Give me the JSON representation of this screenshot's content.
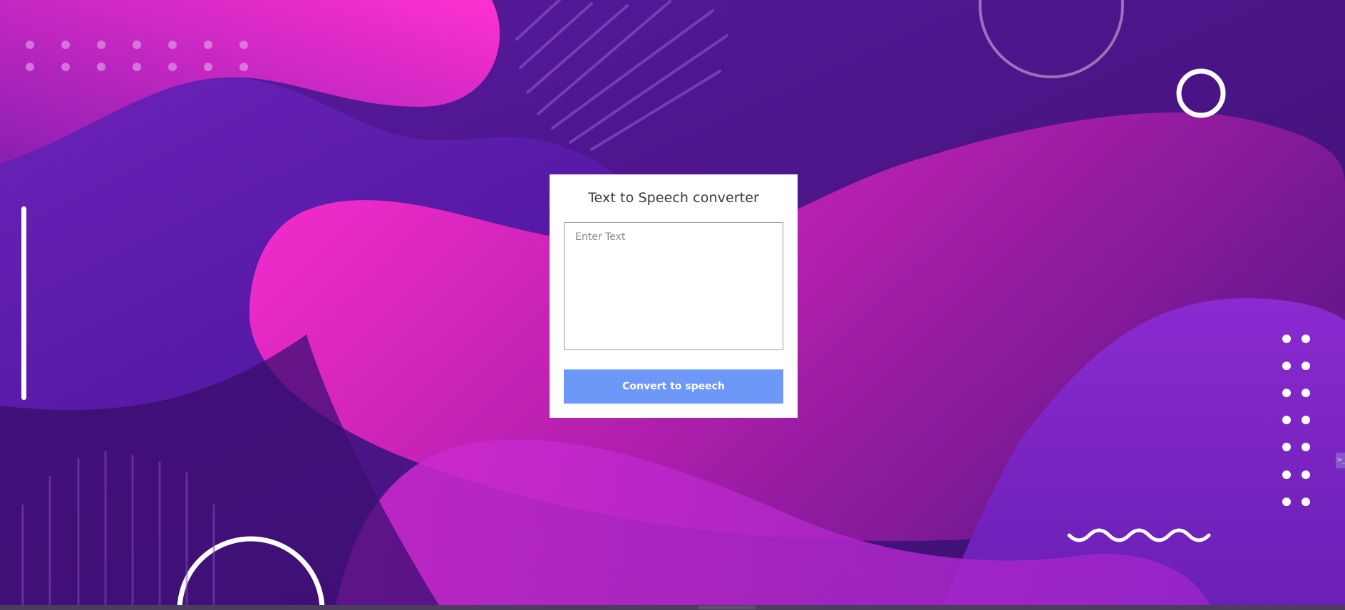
{
  "app": {
    "title": "Text to Speech converter"
  },
  "form": {
    "input_value": "",
    "input_placeholder": "Enter Text",
    "convert_label": "Convert to speech"
  },
  "side_tab": {
    "label": ">_"
  },
  "colors": {
    "background_deep": "#3f1175",
    "background_violet": "#5a18a8",
    "background_pink": "#ff2ed0",
    "button": "#6d98f7",
    "card": "#ffffff"
  }
}
